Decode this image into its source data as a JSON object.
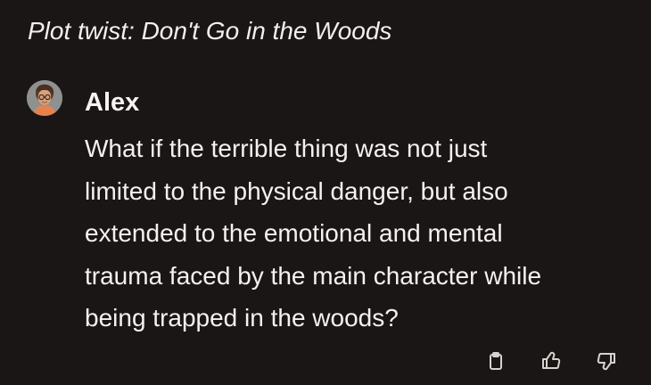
{
  "chat": {
    "title": "Plot twist: Don't Go in the Woods"
  },
  "message": {
    "author": "Alex",
    "text_lines": [
      "What if the terrible thing was not just",
      "limited to the physical danger, but also",
      "extended to the emotional and mental",
      "trauma faced by the main character while",
      "being trapped in the woods?"
    ]
  },
  "actions": {
    "icons": [
      "clipboard-icon",
      "thumbs-up-icon",
      "thumbs-down-icon"
    ]
  },
  "colors": {
    "background": "#1b1616",
    "text": "#f4f1ef",
    "icon": "#d8d2ce"
  }
}
